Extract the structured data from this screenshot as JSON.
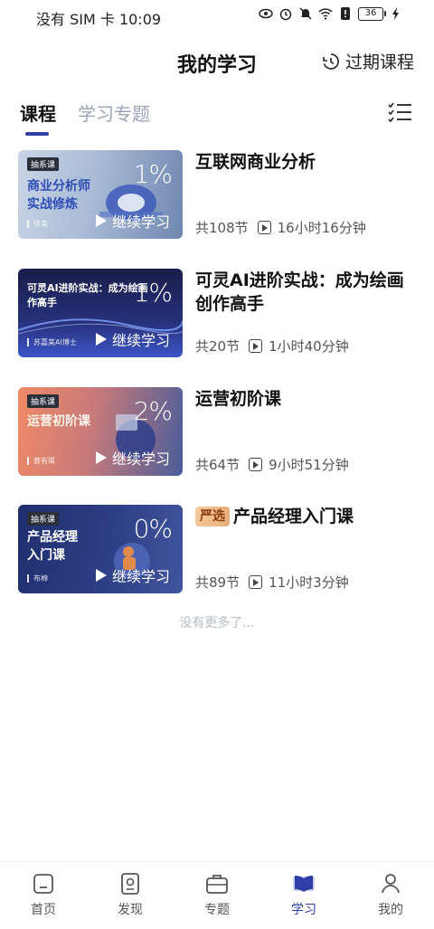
{
  "status_bar": {
    "left_text": "没有 SIM 卡 10:09",
    "battery": "36"
  },
  "header": {
    "title": "我的学习",
    "expired_label": "过期课程"
  },
  "tabs": [
    {
      "label": "课程"
    },
    {
      "label": "学习专题"
    }
  ],
  "courses": [
    {
      "thumb_tag": "抽系课",
      "thumb_title_1": "商业分析师",
      "thumb_title_2": "实战修炼",
      "thumb_author": "徐美",
      "progress_label": "1%",
      "progress": 0.01,
      "continue_label": "继续学习",
      "title": "互联网商业分析",
      "lessons": "共108节",
      "duration": "16小时16分钟"
    },
    {
      "thumb_tag": "",
      "thumb_title_1": "可灵AI进阶实战：成为绘画",
      "thumb_title_2": "作高手",
      "thumb_author": "苏嘉美AI博士",
      "progress_label": "1%",
      "progress": 0.01,
      "continue_label": "继续学习",
      "title": "可灵AI进阶实战：成为绘画创作高手",
      "lessons": "共20节",
      "duration": "1小时40分钟"
    },
    {
      "thumb_tag": "抽系课",
      "thumb_title_1": "运营初阶课",
      "thumb_title_2": "",
      "thumb_author": "黄有璨",
      "progress_label": "2%",
      "progress": 0.02,
      "continue_label": "继续学习",
      "title": "运营初阶课",
      "lessons": "共64节",
      "duration": "9小时51分钟"
    },
    {
      "thumb_tag": "抽系课",
      "thumb_title_1": "产品经理",
      "thumb_title_2": "入门课",
      "thumb_author": "布棉",
      "progress_label": "0%",
      "progress": 0.0,
      "continue_label": "继续学习",
      "badge": "严选",
      "title": "产品经理入门课",
      "lessons": "共89节",
      "duration": "11小时3分钟"
    }
  ],
  "no_more": "没有更多了...",
  "bottom_nav": [
    {
      "label": "首页",
      "icon": "home-icon"
    },
    {
      "label": "发现",
      "icon": "discover-icon"
    },
    {
      "label": "专题",
      "icon": "briefcase-icon"
    },
    {
      "label": "学习",
      "icon": "book-icon"
    },
    {
      "label": "我的",
      "icon": "profile-icon"
    }
  ],
  "colors": {
    "accent": "#2f3ea3",
    "inactive_tab": "#9aa3b8",
    "no_more": "#b6bcc8"
  }
}
